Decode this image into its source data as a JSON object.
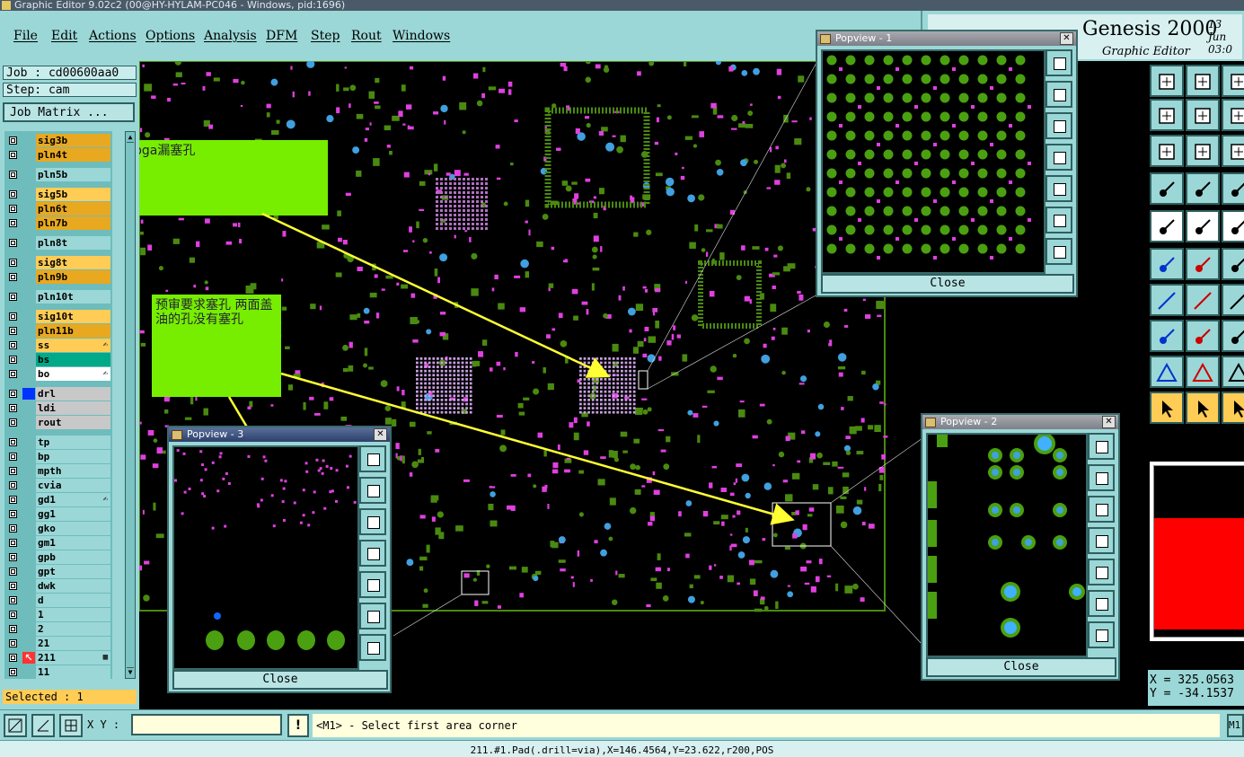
{
  "window": {
    "title": "Graphic Editor 9.02c2 (00@HY-HYLAM-PC046 - Windows, pid:1696)"
  },
  "menu": [
    "File",
    "Edit",
    "Actions",
    "Options",
    "Analysis",
    "DFM",
    "Step",
    "Rout",
    "Windows"
  ],
  "brand": {
    "title": "Genesis 2000",
    "subtitle": "Graphic Editor",
    "date_line1": "13 Jun",
    "date_line2": "03:0"
  },
  "job": {
    "job_label": "Job : cd00600aa0",
    "step_label": "Step: cam",
    "matrix_button": "Job Matrix ..."
  },
  "layers": [
    {
      "name": "sig3b",
      "color": "#e8a820",
      "group": 1
    },
    {
      "name": "pln4t",
      "color": "#e8a820",
      "group": 1
    },
    {
      "name": "pln5b",
      "color": "#9bd7d7",
      "group": 2
    },
    {
      "name": "sig5b",
      "color": "#ffcc55",
      "group": 3
    },
    {
      "name": "pln6t",
      "color": "#e8a820",
      "group": 3
    },
    {
      "name": "pln7b",
      "color": "#e8a820",
      "group": 3
    },
    {
      "name": "pln8t",
      "color": "#9bd7d7",
      "group": 4
    },
    {
      "name": "sig8t",
      "color": "#ffcc55",
      "group": 5
    },
    {
      "name": "pln9b",
      "color": "#e8a820",
      "group": 5
    },
    {
      "name": "pln10t",
      "color": "#9bd7d7",
      "group": 6
    },
    {
      "name": "sig10t",
      "color": "#ffcc55",
      "group": 7
    },
    {
      "name": "pln11b",
      "color": "#e8a820",
      "group": 7
    },
    {
      "name": "ss",
      "color": "#ffcc55",
      "group": 7,
      "mark": "✍"
    },
    {
      "name": "bs",
      "color": "#00aa88",
      "group": 7
    },
    {
      "name": "bo",
      "color": "#ffffff",
      "group": 7,
      "mark": "✍"
    },
    {
      "name": "drl",
      "color": "#c8c8c8",
      "group": 8,
      "icon": "#0033ff"
    },
    {
      "name": "ldi",
      "color": "#c8c8c8",
      "group": 8
    },
    {
      "name": "rout",
      "color": "#c8c8c8",
      "group": 8
    },
    {
      "name": "tp",
      "color": "#9bd7d7",
      "group": 9
    },
    {
      "name": "bp",
      "color": "#9bd7d7",
      "group": 9
    },
    {
      "name": "mpth",
      "color": "#9bd7d7",
      "group": 9
    },
    {
      "name": "cvia",
      "color": "#9bd7d7",
      "group": 9
    },
    {
      "name": "gd1",
      "color": "#9bd7d7",
      "group": 9,
      "mark": "✍"
    },
    {
      "name": "gg1",
      "color": "#9bd7d7",
      "group": 9
    },
    {
      "name": "gko",
      "color": "#9bd7d7",
      "group": 9
    },
    {
      "name": "gm1",
      "color": "#9bd7d7",
      "group": 9
    },
    {
      "name": "gpb",
      "color": "#9bd7d7",
      "group": 9
    },
    {
      "name": "gpt",
      "color": "#9bd7d7",
      "group": 9
    },
    {
      "name": "dwk",
      "color": "#9bd7d7",
      "group": 9
    },
    {
      "name": "d",
      "color": "#9bd7d7",
      "group": 9
    },
    {
      "name": "1",
      "color": "#9bd7d7",
      "group": 9
    },
    {
      "name": "2",
      "color": "#9bd7d7",
      "group": 9
    },
    {
      "name": "21",
      "color": "#9bd7d7",
      "group": 9
    },
    {
      "name": "211",
      "color": "#9bd7d7",
      "group": 9,
      "icon": "#ff3333",
      "mark": "▦",
      "active": true
    },
    {
      "name": "11",
      "color": "#9bd7d7",
      "group": 9
    }
  ],
  "selected": "Selected : 1",
  "notes": [
    {
      "text": "bga漏塞孔"
    },
    {
      "text": "预审要求塞孔 两面盖油的孔没有塞孔"
    }
  ],
  "popviews": [
    {
      "title": "Popview - 1",
      "close": "Close"
    },
    {
      "title": "Popview - 2",
      "close": "Close"
    },
    {
      "title": "Popview - 3",
      "close": "Close"
    }
  ],
  "coords": {
    "x": "X = 325.0563",
    "y": "Y = -34.1537"
  },
  "status": {
    "xy_label": "X Y :",
    "xy_value": "",
    "warn": "!",
    "message": "<M1> - Select first area corner",
    "mode": "M1"
  },
  "footer": "211.#1.Pad(.drill=via),X=146.4564,Y=23.622,r200,POS",
  "colors": {
    "panel": "#9bd7d7",
    "pad": "#4a8a10",
    "smd": "#e040e0",
    "via": "#40a0e0",
    "note": "#77ee00"
  }
}
